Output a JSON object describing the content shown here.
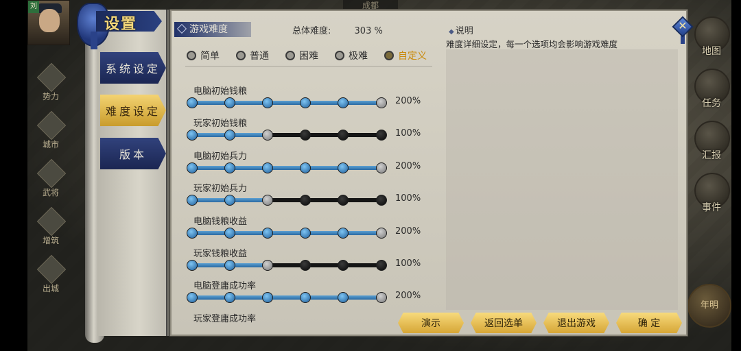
{
  "background": {
    "portrait_tag": "刘",
    "city_name": "成都",
    "left_nav": [
      {
        "label": "势力",
        "icon": "faction-icon"
      },
      {
        "label": "城市",
        "icon": "city-icon"
      },
      {
        "label": "武将",
        "icon": "general-icon"
      },
      {
        "label": "增筑",
        "icon": "build-icon"
      },
      {
        "label": "出城",
        "icon": "exit-city-icon"
      }
    ],
    "right_nav": [
      {
        "label": "地图",
        "icon": "map-icon"
      },
      {
        "label": "任务",
        "icon": "task-icon"
      },
      {
        "label": "汇报",
        "icon": "report-icon"
      },
      {
        "label": "事件",
        "icon": "event-icon"
      }
    ],
    "year_badge": "年明"
  },
  "dialog": {
    "title": "设置",
    "tabs": [
      {
        "label": "系统设定",
        "active": false
      },
      {
        "label": "难度设定",
        "active": true
      },
      {
        "label": "版本",
        "active": false
      }
    ],
    "difficulty_label": "游戏难度",
    "overall_label": "总体难度:",
    "overall_value": "303 %",
    "presets": [
      {
        "label": "简单",
        "selected": false
      },
      {
        "label": "普通",
        "selected": false
      },
      {
        "label": "困难",
        "selected": false
      },
      {
        "label": "极难",
        "selected": false
      },
      {
        "label": "自定义",
        "selected": true
      }
    ],
    "sliders": [
      {
        "name": "电脑初始钱粮",
        "value": "200%",
        "level": 5
      },
      {
        "name": "玩家初始钱粮",
        "value": "100%",
        "level": 2
      },
      {
        "name": "电脑初始兵力",
        "value": "200%",
        "level": 5
      },
      {
        "name": "玩家初始兵力",
        "value": "100%",
        "level": 2
      },
      {
        "name": "电脑钱粮收益",
        "value": "200%",
        "level": 5
      },
      {
        "name": "玩家钱粮收益",
        "value": "100%",
        "level": 2
      },
      {
        "name": "电脑登庸成功率",
        "value": "200%",
        "level": 5
      },
      {
        "name": "玩家登庸成功率",
        "value": "",
        "level": null
      }
    ],
    "explanation_title": "说明",
    "explanation_text": "难度详细设定，每一个选项均会影响游戏难度",
    "buttons": {
      "demo": "演示",
      "back": "返回选单",
      "exit": "退出游戏",
      "ok": "确 定"
    }
  },
  "colors": {
    "accent_blue": "#2a4080",
    "accent_gold": "#d6a636",
    "selected_preset": "#c98a0c"
  }
}
